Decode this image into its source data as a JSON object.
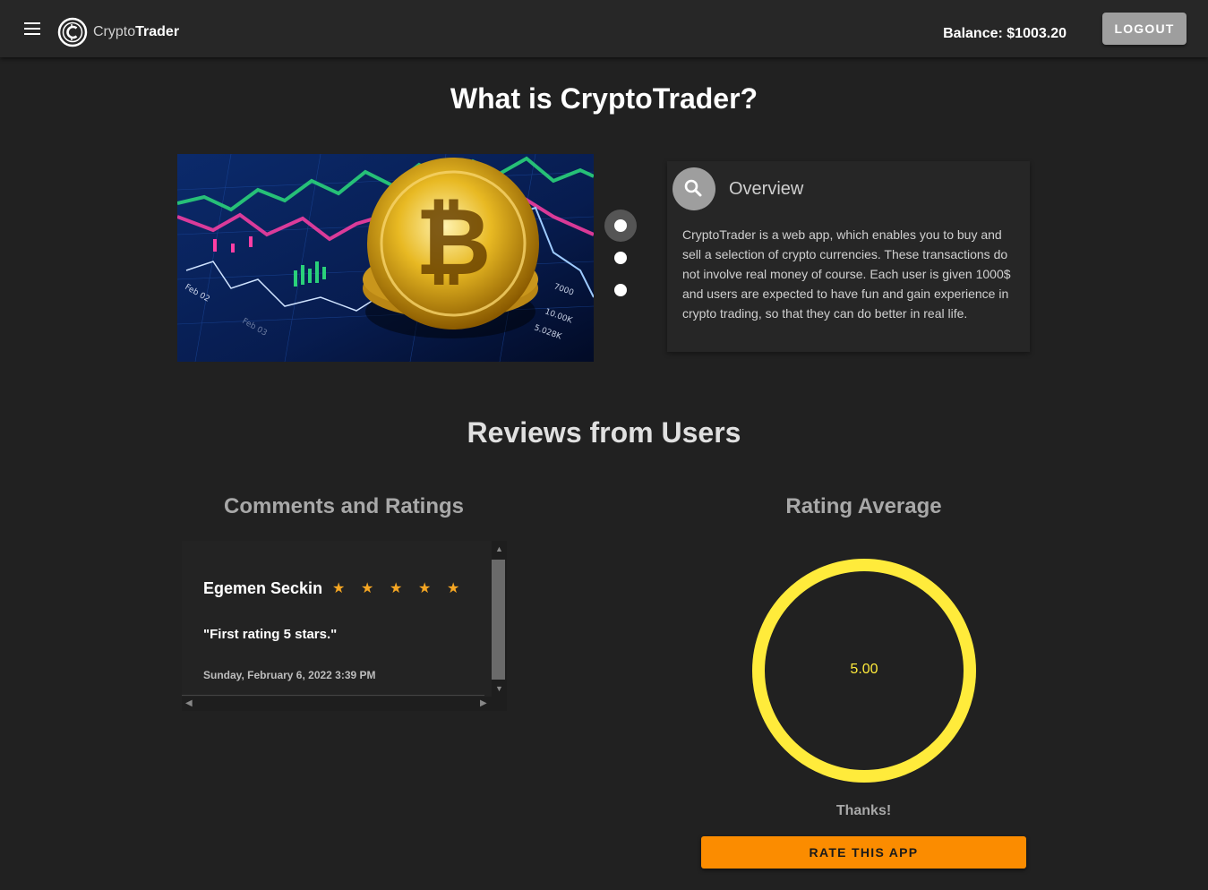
{
  "header": {
    "brand_part1": "Crypto",
    "brand_part2": "Trader",
    "balance": "Balance: $1003.20",
    "logout_label": "LOGOUT"
  },
  "about": {
    "heading": "What is CryptoTrader?",
    "carousel": {
      "slide_count": 3,
      "active_index": 0
    },
    "overview_title": "Overview",
    "overview_text": "CryptoTrader is a web app, which enables you to buy and sell a selection of crypto currencies. These transactions do not involve real money of course. Each user is given 1000$ and users are expected to have fun and gain experience in crypto trading, so that they can do better in real life."
  },
  "reviews": {
    "heading": "Reviews from Users",
    "comments_heading": "Comments and Ratings",
    "rating_heading": "Rating Average",
    "comments": [
      {
        "name": "Egemen Seckin",
        "stars": 5,
        "text": "\"First rating 5 stars.\"",
        "date": "Sunday, February 6, 2022 3:39 PM"
      }
    ],
    "average_value": "5.00",
    "average_fraction": 1.0,
    "thanks": "Thanks!",
    "rate_button": "RATE THIS APP"
  },
  "colors": {
    "background": "#212121",
    "topbar": "#272727",
    "accent_orange": "#fb8c00",
    "star": "#f5a623",
    "ring": "#ffeb3b",
    "logout": "#9e9e9e"
  },
  "icons": {
    "menu": "menu-icon",
    "logo": "logo-icon",
    "overview": "search-icon",
    "star": "star-icon"
  }
}
